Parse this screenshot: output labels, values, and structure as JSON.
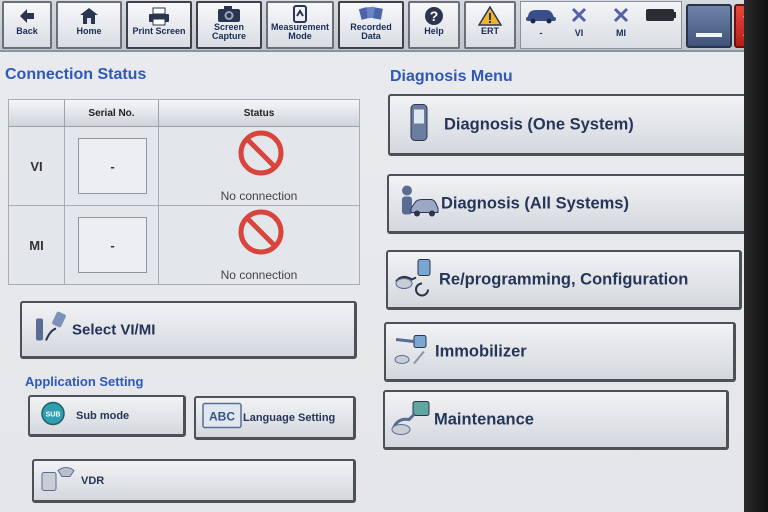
{
  "toolbar": {
    "back": "Back",
    "home": "Home",
    "print_screen": "Print Screen",
    "screen_capture_1": "Screen",
    "screen_capture_2": "Capture",
    "measurement_1": "Measurement",
    "measurement_2": "Mode",
    "recorded_1": "Recorded",
    "recorded_2": "Data",
    "help": "Help",
    "ert": "ERT",
    "status_vehicle": "-",
    "status_vi": "VI",
    "status_mi": "MI"
  },
  "connection_status": {
    "title": "Connection Status",
    "col_serial": "Serial No.",
    "col_status": "Status",
    "rows": [
      {
        "label": "VI",
        "serial": "-",
        "status": "No connection"
      },
      {
        "label": "MI",
        "serial": "-",
        "status": "No connection"
      }
    ]
  },
  "select_vi_mi": "Select VI/MI",
  "application_setting": {
    "title": "Application Setting",
    "sub_mode": "Sub mode",
    "sub_mode_icon_text": "SUB",
    "language_setting": "Language Setting",
    "language_icon_text": "ABC",
    "vdr": "VDR"
  },
  "diagnosis_menu": {
    "title": "Diagnosis Menu",
    "items": [
      {
        "label": "Diagnosis (One System)"
      },
      {
        "label": "Diagnosis (All Systems)"
      },
      {
        "label": "Re/programming, Configuration"
      },
      {
        "label": "Immobilizer"
      },
      {
        "label": "Maintenance"
      }
    ]
  },
  "colors": {
    "heading": "#2f58b8",
    "no_connection_icon": "#d7453c",
    "close_button": "#c92c22",
    "status_x": "#5560a8"
  }
}
